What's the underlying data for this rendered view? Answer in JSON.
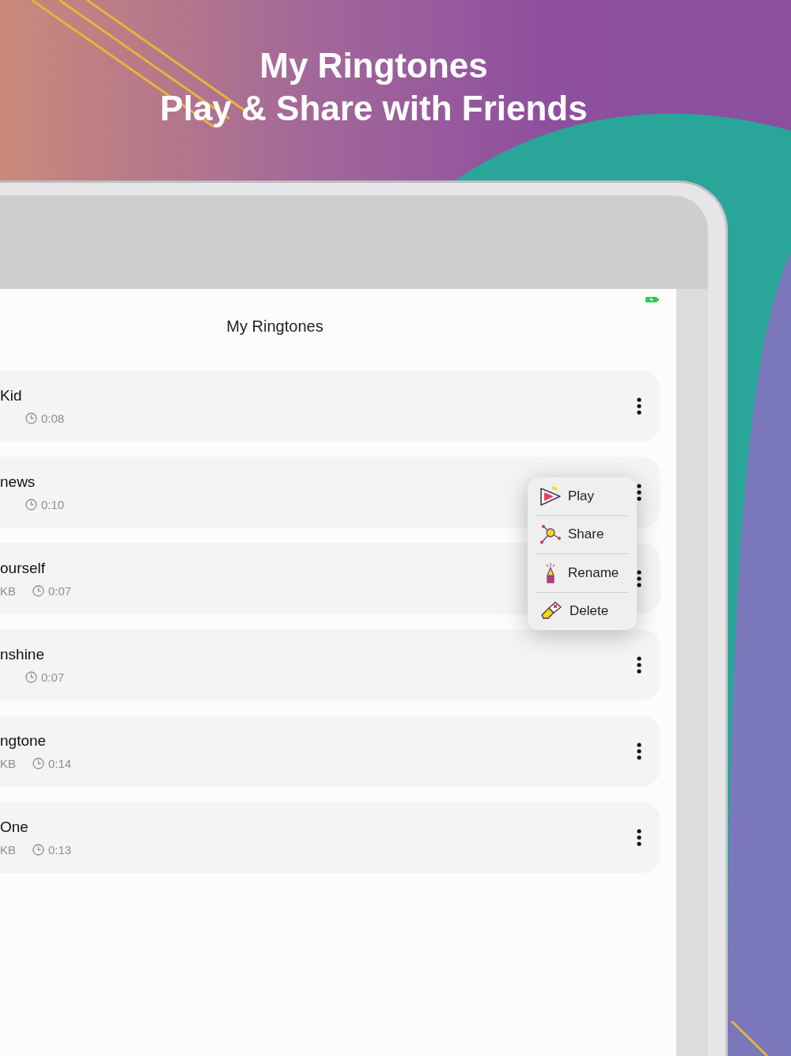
{
  "headline": [
    "My Ringtones",
    "Play & Share with Friends"
  ],
  "screen": {
    "title": "My Ringtones"
  },
  "ringtones": [
    {
      "name": "Kid",
      "duration": "0:08"
    },
    {
      "name": "news",
      "duration": "0:10"
    },
    {
      "name": "ourself",
      "size": "KB",
      "duration": "0:07"
    },
    {
      "name": "nshine",
      "duration": "0:07"
    },
    {
      "name": "ngtone",
      "size": "KB",
      "duration": "0:14"
    },
    {
      "name": "One",
      "size": "KB",
      "duration": "0:13"
    }
  ],
  "menu": {
    "items": [
      {
        "kind": "play",
        "label": "Play"
      },
      {
        "kind": "share",
        "label": "Share"
      },
      {
        "kind": "rename",
        "label": "Rename"
      },
      {
        "kind": "delete",
        "label": "Delete"
      }
    ]
  }
}
